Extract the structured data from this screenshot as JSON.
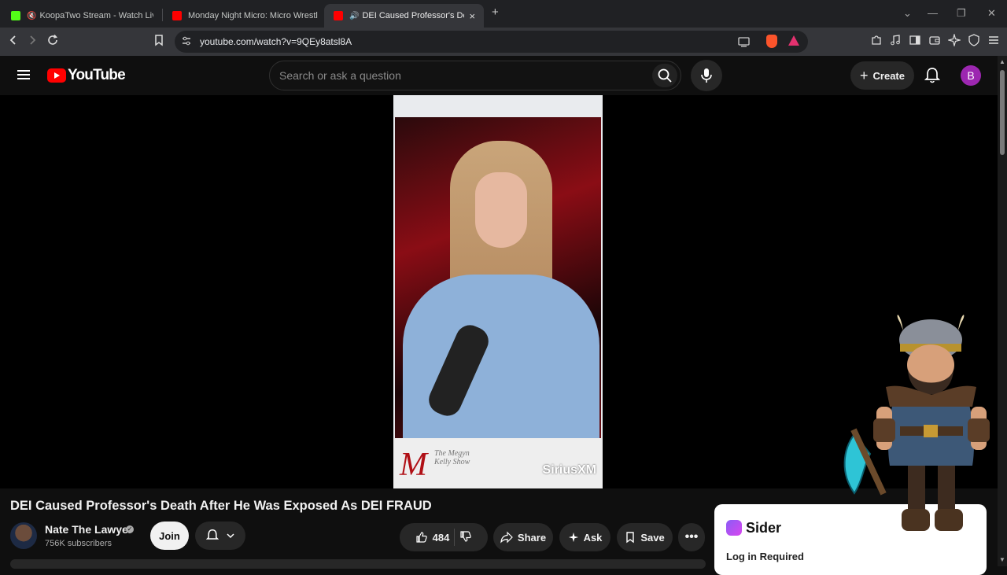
{
  "browser": {
    "tabs": [
      {
        "title": "KoopaTwo Stream - Watch Live o",
        "favicon_color": "#53fc18",
        "active": false
      },
      {
        "title": "Monday Night Micro: Micro Wrestlin",
        "favicon_color": "#ff0000",
        "active": false
      },
      {
        "title": "DEI Caused Professor's Death",
        "favicon_color": "#ff0000",
        "active": true
      }
    ],
    "url": "youtube.com/watch?v=9QEy8atsl8A",
    "new_tab_glyph": "+",
    "close_glyph": "×",
    "window_controls": [
      "⌄",
      "—",
      "❐",
      "✕"
    ]
  },
  "youtube": {
    "logo_text": "YouTube",
    "search_placeholder": "Search or ask a question",
    "create_label": "Create",
    "avatar_letter": "B"
  },
  "video": {
    "overlay_brand_mark": "M",
    "overlay_show_name": "The Megyn Kelly Show",
    "overlay_network": "SiriusXM"
  },
  "meta": {
    "title": "DEI Caused Professor's Death After He Was Exposed As DEI FRAUD",
    "channel_name": "Nate The Lawyer",
    "subscribers": "756K subscribers",
    "join_label": "Join",
    "likes": "484",
    "share_label": "Share",
    "ask_label": "Ask",
    "save_label": "Save"
  },
  "sider": {
    "name": "Sider",
    "status": "Log in Required"
  },
  "colors": {
    "brand_red": "#ff0000",
    "avatar_bg": "#9c27b0",
    "bg": "#0f0f0f"
  }
}
